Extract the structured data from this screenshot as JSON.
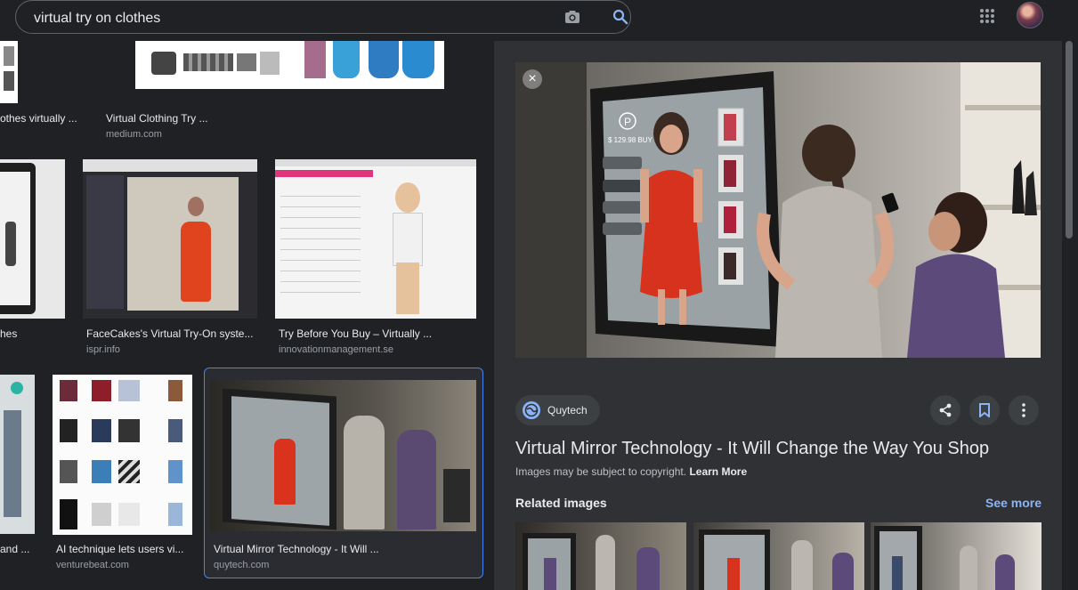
{
  "search": {
    "query": "virtual try on clothes"
  },
  "icons": {
    "camera": "camera-icon",
    "search": "search-icon",
    "apps": "apps-grid-icon",
    "avatar": "avatar"
  },
  "results": [
    {
      "caption": "othes virtually ...",
      "source": ""
    },
    {
      "caption": "Virtual Clothing Try ...",
      "source": "medium.com"
    },
    {
      "caption": "hes",
      "source": ""
    },
    {
      "caption": "FaceCakes's Virtual Try-On syste...",
      "source": "ispr.info"
    },
    {
      "caption": "Try Before You Buy – Virtually ...",
      "source": "innovationmanagement.se"
    },
    {
      "caption": "and ...",
      "source": ""
    },
    {
      "caption": "AI technique lets users vi...",
      "source": "venturebeat.com"
    },
    {
      "caption": "Virtual Mirror Technology - It Will ...",
      "source": "quytech.com"
    }
  ],
  "panel": {
    "site": "Quytech",
    "title": "Virtual Mirror Technology - It Will Change the Way You Shop",
    "copyright_text": "Images may be subject to copyright.",
    "learn_more": "Learn More",
    "related_label": "Related images",
    "see_more": "See more",
    "close_glyph": "×",
    "mirror_price": "$ 129.98 BUY",
    "mirror_letter": "P"
  },
  "colors": {
    "accent": "#8ab4f8",
    "selected_border": "#4285f4",
    "background": "#202124",
    "panel": "#303134"
  }
}
